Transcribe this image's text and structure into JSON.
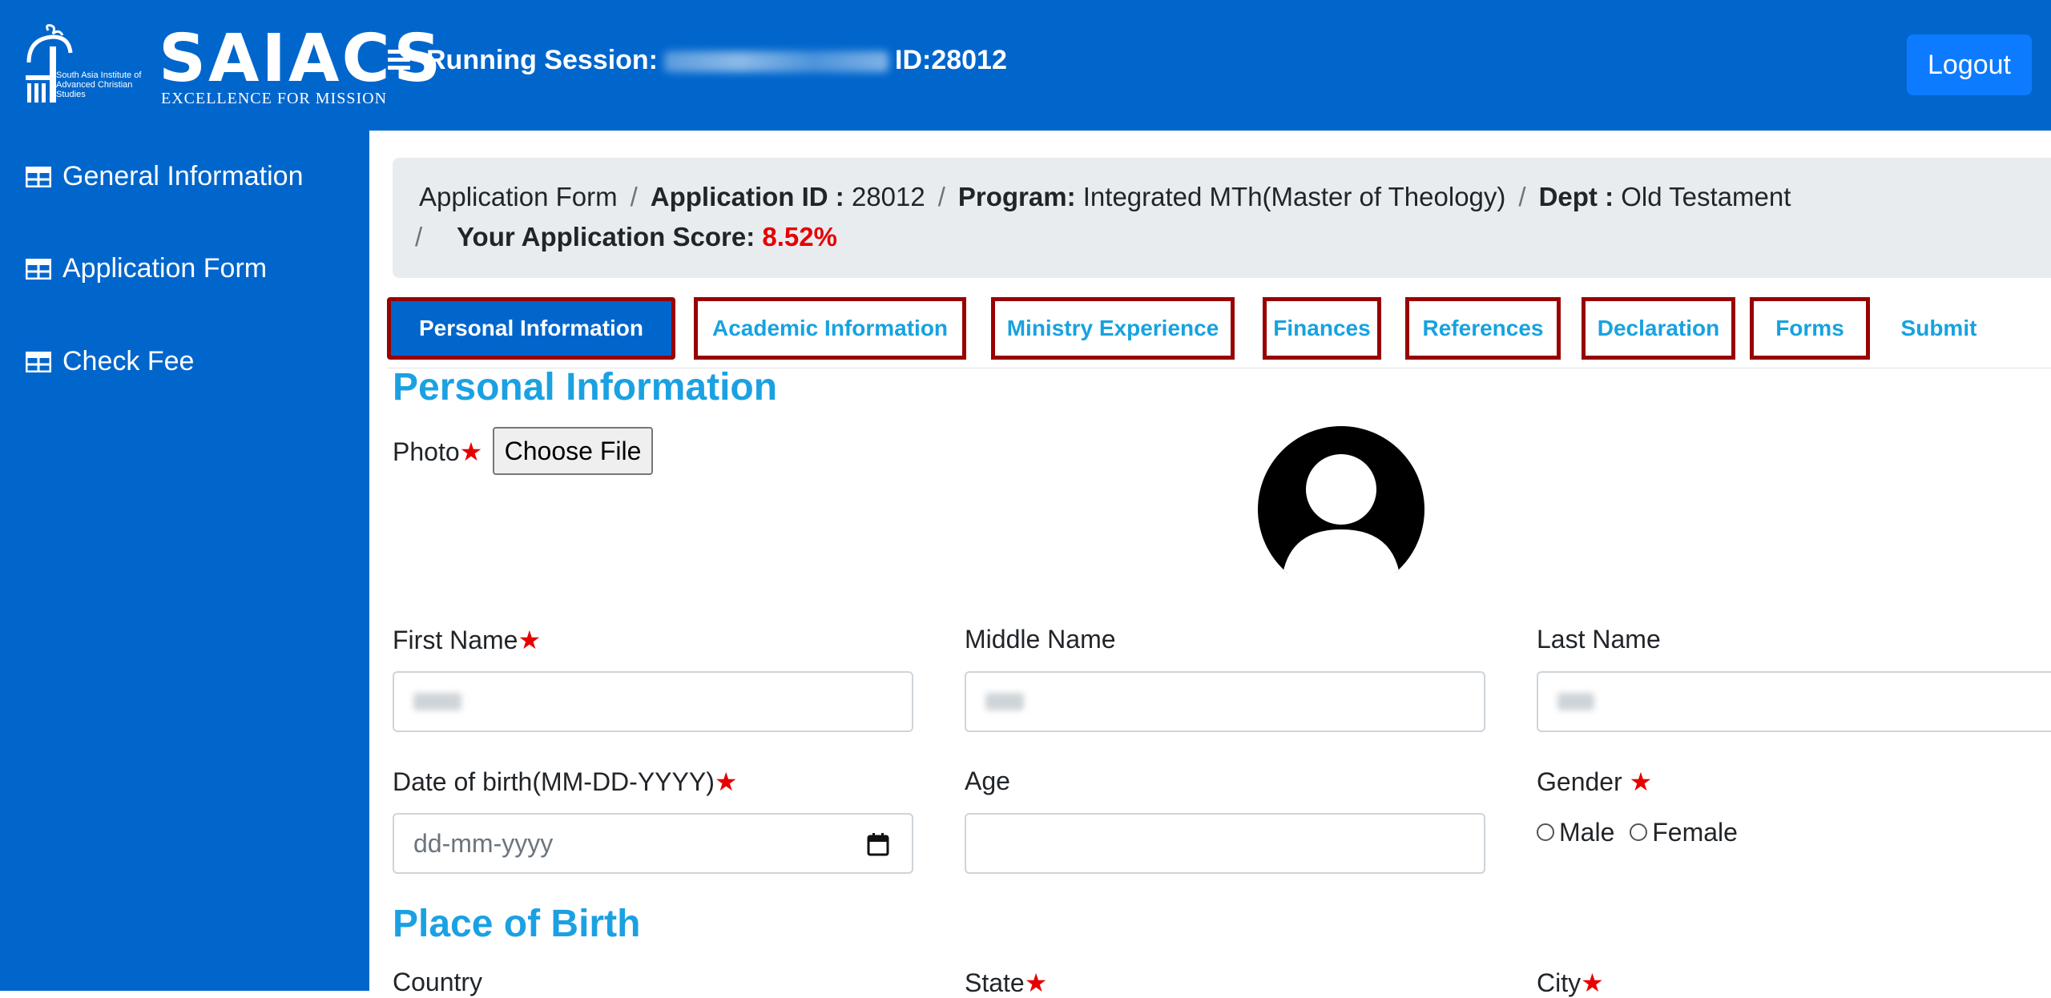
{
  "header": {
    "logo_name": "SAIACS",
    "logo_tagline": "EXCELLENCE FOR MISSION",
    "logo_small": "South Asia Institute of Advanced Christian Studies",
    "session_label": "Running Session:",
    "session_id": "ID:28012",
    "logout_label": "Logout"
  },
  "sidebar": {
    "items": [
      {
        "label": "General Information",
        "icon": "table-icon"
      },
      {
        "label": "Application Form",
        "icon": "table-icon"
      },
      {
        "label": "Check Fee",
        "icon": "table-icon"
      }
    ]
  },
  "breadcrumb": {
    "item1": "Application Form",
    "app_id_label": "Application ID :",
    "app_id_value": "28012",
    "program_label": "Program:",
    "program_value": "Integrated MTh(Master of Theology)",
    "dept_label": "Dept :",
    "dept_value": "Old Testament",
    "score_label": "Your Application Score:",
    "score_value": "8.52%",
    "separator": "/"
  },
  "tabs": [
    {
      "label": "Personal Information",
      "active": true
    },
    {
      "label": "Academic Information"
    },
    {
      "label": "Ministry Experience"
    },
    {
      "label": "Finances"
    },
    {
      "label": "References"
    },
    {
      "label": "Declaration"
    },
    {
      "label": "Forms"
    },
    {
      "label": "Submit"
    }
  ],
  "form": {
    "section_title": "Personal Information",
    "photo_label": "Photo",
    "choose_file": "Choose File",
    "required_mark": "★",
    "first_name_label": "First Name",
    "middle_name_label": "Middle Name",
    "last_name_label": "Last Name",
    "dob_label": "Date of birth(MM-DD-YYYY)",
    "dob_placeholder": "dd-mm-yyyy",
    "age_label": "Age",
    "gender_label": "Gender",
    "gender_male": "Male",
    "gender_female": "Female",
    "place_title": "Place of Birth",
    "country_label": "Country",
    "state_label": "State",
    "city_label": "City"
  },
  "colors": {
    "brand_blue": "#0066cc",
    "tab_text": "#17a2e0",
    "tab_border": "#990000",
    "required": "#e60000"
  }
}
